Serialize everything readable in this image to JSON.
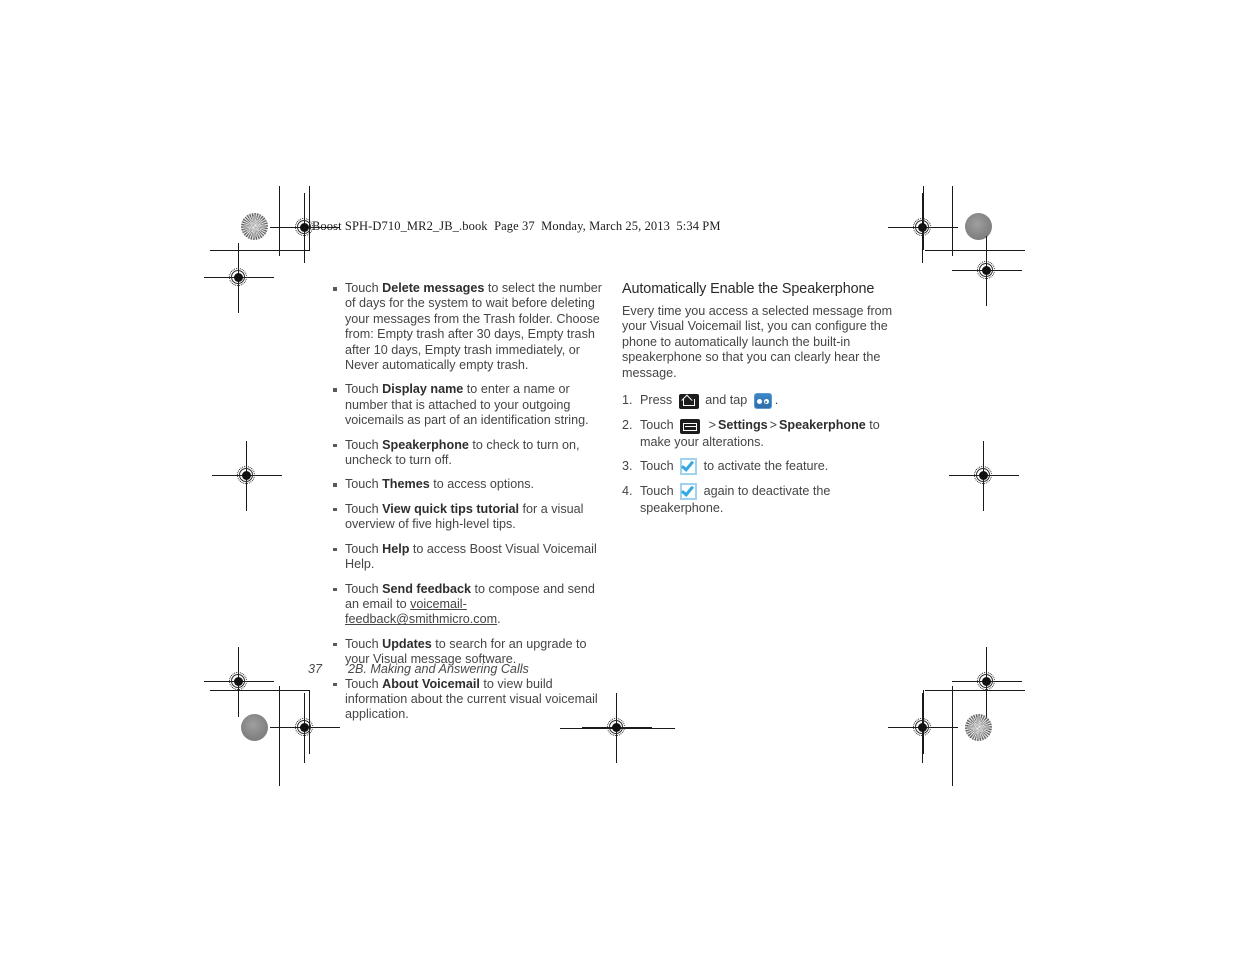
{
  "book_header": "Boost SPH-D710_MR2_JB_.book  Page 37  Monday, March 25, 2013  5:34 PM",
  "left_column": {
    "bullets": [
      {
        "prefix": "Touch ",
        "bold": "Delete messages",
        "suffix": " to select the number of days for the system to wait before deleting your messages from the Trash folder. Choose from: Empty trash after 30 days, Empty trash after 10 days, Empty trash immediately, or Never automatically empty trash."
      },
      {
        "prefix": "Touch ",
        "bold": "Display name",
        "suffix": " to enter a name or number that is attached to your outgoing voicemails as part of an identification string."
      },
      {
        "prefix": "Touch ",
        "bold": "Speakerphone",
        "suffix": " to check to turn on, uncheck to turn off."
      },
      {
        "prefix": "Touch ",
        "bold": "Themes",
        "suffix": " to access options."
      },
      {
        "prefix": "Touch ",
        "bold": "View quick tips tutorial",
        "suffix": " for a visual overview of five high-level tips."
      },
      {
        "prefix": "Touch ",
        "bold": "Help",
        "suffix": " to access Boost Visual Voicemail Help."
      },
      {
        "prefix": "Touch ",
        "bold": "Send feedback",
        "suffix": " to compose and send an email to ",
        "link": "voicemail-feedback@smithmicro.com",
        "tail": "."
      },
      {
        "prefix": "Touch ",
        "bold": "Updates",
        "suffix": " to search for an upgrade to your Visual message software."
      },
      {
        "prefix": "Touch ",
        "bold": "About Voicemail",
        "suffix": " to view build information about the current visual voicemail application."
      }
    ]
  },
  "right_column": {
    "section_title": "Automatically Enable the Speakerphone",
    "intro": "Every time you access a selected message from your Visual Voicemail list, you can configure the phone to automatically launch the built-in speakerphone so that you can clearly hear the message.",
    "steps": {
      "step1": {
        "part1": "Press",
        "icon1": "home-key-icon",
        "part2": "and tap",
        "icon2": "visual-voicemail-app-icon",
        "part3": "."
      },
      "step2": {
        "part1": "Touch",
        "icon1": "menu-key-icon",
        "sep1": ">",
        "bold1": "Settings",
        "sep2": ">",
        "bold2": "Speakerphone",
        "part2": " to make your alterations."
      },
      "step3": {
        "part1": "Touch",
        "icon1": "checkbox-checked-icon",
        "part2": "to activate the feature."
      },
      "step4": {
        "part1": "Touch",
        "icon1": "checkbox-checked-icon",
        "part2": "again to deactivate the speakerphone."
      }
    }
  },
  "footer": {
    "page_number": "37",
    "chapter": "2B. Making and Answering Calls"
  },
  "colors": {
    "accent_blue": "#35a8e0",
    "app_icon_blue": "#3d87c9",
    "text": "#454545",
    "icon_dark": "#1d1d1d"
  }
}
